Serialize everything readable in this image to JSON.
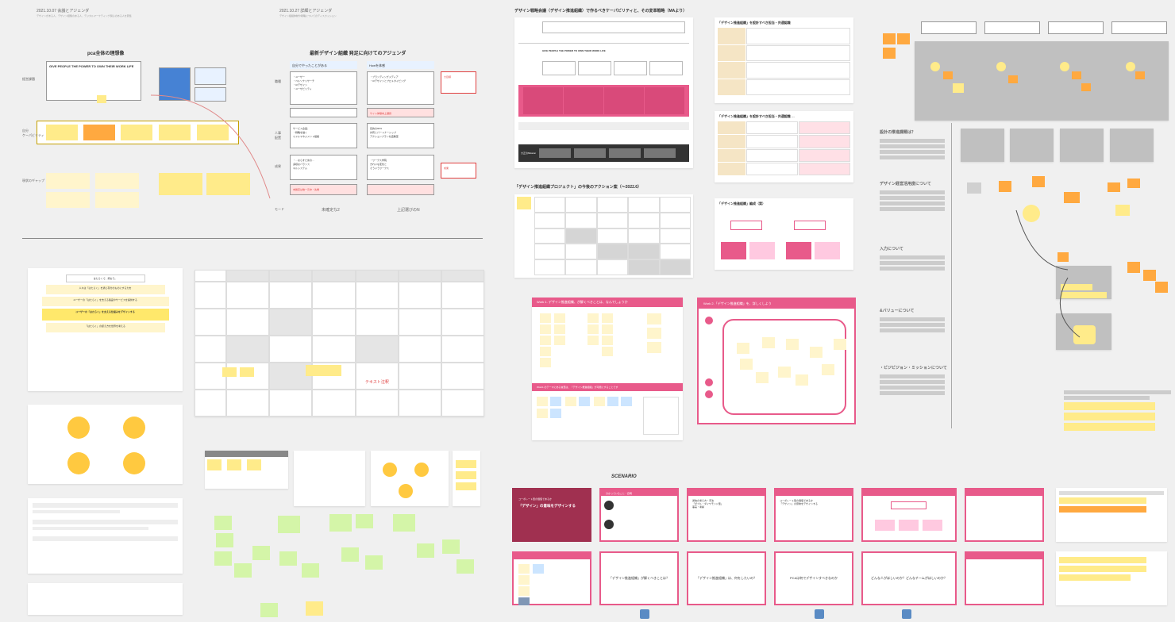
{
  "sections": {
    "top_left_date": "2021.10.07 会議とアジェンダ",
    "top_mid_date": "2021.10.27 詳細とアジェンダ",
    "hd1": "pca全体の理想像",
    "mission": "GIVE PEOPLE THE POWER TO OWN THEIR WORK LIFE",
    "agenda_title": "最新デザイン組織 発足に向けてのアジェンダ",
    "frame_a_label": "自分でやったことがある",
    "frame_b_label": "Howを体感",
    "design_proj": "デザイン戦略会議（デザイン推進組織）で作るべきケーパビリティと、その変革戦略（MAより）",
    "action_table": "「デザイン推進組織プロジェクト」の今後のアクション案（～2022.6）",
    "work1": "Work 1. デザイン推進組織、が解くべきことは、なんでしょうか",
    "work2": "Work 2.「デザイン推進組織」を、詳しくしよう",
    "goal_panel_1": "はたらくで、笑おう。",
    "goal_panel_2": "ユーザーの「はたらく」を支える製品やサービスを提供する",
    "goal_panel_3": "ユーザーの「はたらく」を支える仕組みをデザインする",
    "sidebar_1": "設計の推進課題は？",
    "sidebar_2": "デザイン経営活用度について",
    "sidebar_3": "入力について",
    "sidebar_4": "&バリューについて",
    "sidebar_5": "・ビジビジョン・ミッションについて",
    "scenario": "SCENARIO",
    "maroon_slide": "「デザイン」の意味をデザインする",
    "slide_q1": "「デザイン推進組織」が解くべきことは？",
    "slide_q2": "「デザイン推進組織」は、何をしたいの？",
    "slide_q3": "PCAは何でデザインすべきなのか",
    "slide_q4": "どんな人がほしいのか？どんなチームがほしいのか？"
  },
  "colors": {
    "accent_pink": "#e85a8a",
    "accent_yellow": "#ffeb8a",
    "accent_orange": "#ffa940",
    "accent_blue": "#4682d4"
  }
}
